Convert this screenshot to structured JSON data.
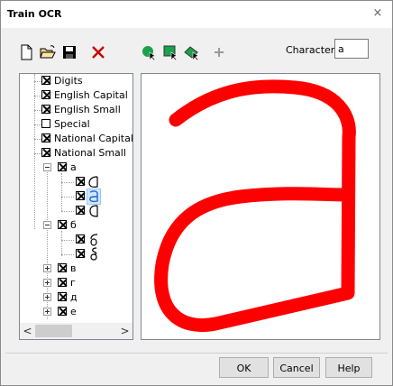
{
  "window": {
    "title": "Train OCR",
    "close_glyph": "×"
  },
  "toolbar": {
    "buttons": [
      {
        "name": "new-icon"
      },
      {
        "name": "open-folder-icon"
      },
      {
        "name": "save-icon"
      },
      {
        "name": "delete-icon",
        "color": "#cc0000"
      },
      {
        "name": "pen-tool-icon",
        "color": "#1aa34a"
      },
      {
        "name": "select-region-icon",
        "color": "#1aa34a"
      },
      {
        "name": "eraser-tool-icon",
        "color": "#1aa34a"
      },
      {
        "name": "add-icon",
        "enabled": false
      }
    ],
    "character_label": "Character:",
    "character_value": "a"
  },
  "tree": {
    "items": [
      {
        "label": "Digits",
        "checked": true
      },
      {
        "label": "English Capital",
        "checked": true
      },
      {
        "label": "English Small",
        "checked": true
      },
      {
        "label": "Special",
        "checked": false
      },
      {
        "label": "National Capital",
        "checked": true
      },
      {
        "label": "National Small",
        "checked": true
      },
      {
        "label": "а",
        "checked": true
      },
      {
        "label": "б",
        "checked": true
      },
      {
        "label": "в",
        "checked": true
      },
      {
        "label": "г",
        "checked": true
      },
      {
        "label": "д",
        "checked": true
      },
      {
        "label": "е",
        "checked": true
      }
    ],
    "scroll_left": "<",
    "scroll_right": ">"
  },
  "canvas": {
    "stroke_color": "#ff0000",
    "glyph": "a"
  },
  "buttons": {
    "ok": "OK",
    "cancel": "Cancel",
    "help": "Help"
  }
}
